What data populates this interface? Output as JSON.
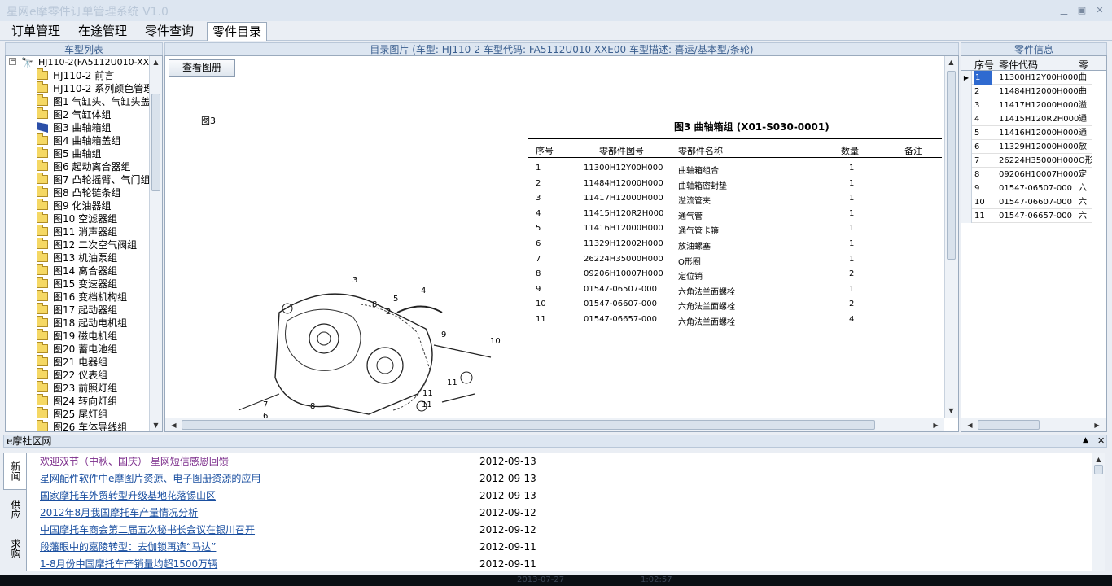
{
  "app": {
    "title": "星网e摩零件订单管理系统 V1.0"
  },
  "menu": [
    "订单管理",
    "在途管理",
    "零件查询",
    "零件目录"
  ],
  "left_panel": {
    "header": "车型列表",
    "root": "HJ110-2(FA5112U010-XXE0",
    "items": [
      "HJ110-2 前言",
      "HJ110-2 系列颜色管理",
      "图1 气缸头、气缸头盖",
      "图2 气缸体组",
      "图3 曲轴箱组",
      "图4 曲轴箱盖组",
      "图5 曲轴组",
      "图6 起动离合器组",
      "图7 凸轮摇臂、气门组",
      "图8 凸轮链条组",
      "图9 化油器组",
      "图10 空滤器组",
      "图11 消声器组",
      "图12 二次空气阀组",
      "图13 机油泵组",
      "图14 离合器组",
      "图15 变速器组",
      "图16 变档机构组",
      "图17 起动器组",
      "图18 起动电机组",
      "图19 磁电机组",
      "图20 蓄电池组",
      "图21 电器组",
      "图22 仪表组",
      "图23 前照灯组",
      "图24 转向灯组",
      "图25 尾灯组",
      "图26 车体导线组"
    ]
  },
  "center_panel": {
    "header": "目录图片 (车型: HJ110-2 车型代码: FA5112U010-XXE00 车型描述: 喜运/基本型/条轮)",
    "button": "查看图册",
    "figure_label": "图3",
    "figure_title": "图3 曲轴箱组 (X01-S030-0001)",
    "table_headers": [
      "序号",
      "零部件图号",
      "零部件名称",
      "数量",
      "备注"
    ],
    "table_rows": [
      [
        "1",
        "11300H12Y00H000",
        "曲轴箱组合",
        "1"
      ],
      [
        "2",
        "11484H12000H000",
        "曲轴箱密封垫",
        "1"
      ],
      [
        "3",
        "11417H12000H000",
        "溢流管夹",
        "1"
      ],
      [
        "4",
        "11415H120R2H000",
        "通气管",
        "1"
      ],
      [
        "5",
        "11416H12000H000",
        "通气管卡箍",
        "1"
      ],
      [
        "6",
        "11329H12002H000",
        "放油螺塞",
        "1"
      ],
      [
        "7",
        "26224H35000H000",
        "O形圈",
        "1"
      ],
      [
        "8",
        "09206H10007H000",
        "定位销",
        "2"
      ],
      [
        "9",
        "01547-06507-000",
        "六角法兰面螺栓",
        "1"
      ],
      [
        "10",
        "01547-06607-000",
        "六角法兰面螺栓",
        "2"
      ],
      [
        "11",
        "01547-06657-000",
        "六角法兰面螺栓",
        "4"
      ]
    ],
    "callouts": [
      "3",
      "4",
      "5",
      "8",
      "2",
      "9",
      "10",
      "7",
      "6",
      "8",
      "11",
      "11",
      "11"
    ]
  },
  "right_panel": {
    "header": "零件信息",
    "columns": [
      "序号",
      "零件代码",
      "零"
    ],
    "rows": [
      [
        "1",
        "11300H12Y00H000",
        "曲"
      ],
      [
        "2",
        "11484H12000H000",
        "曲"
      ],
      [
        "3",
        "11417H12000H000",
        "溢"
      ],
      [
        "4",
        "11415H120R2H000",
        "通"
      ],
      [
        "5",
        "11416H12000H000",
        "通"
      ],
      [
        "6",
        "11329H12000H000",
        "放"
      ],
      [
        "7",
        "26224H35000H000",
        "O形"
      ],
      [
        "8",
        "09206H10007H000",
        "定"
      ],
      [
        "9",
        "01547-06507-000",
        "六"
      ],
      [
        "10",
        "01547-06607-000",
        "六"
      ],
      [
        "11",
        "01547-06657-000",
        "六"
      ]
    ]
  },
  "bottom_panel": {
    "header": "e摩社区网",
    "tabs": [
      "新闻",
      "供应",
      "求购"
    ],
    "news": [
      {
        "title": "欢迎双节（中秋、国庆） 星网短信感恩回馈",
        "date": "2012-09-13"
      },
      {
        "title": "星网配件软件中e摩图片资源、电子图册资源的应用",
        "date": "2012-09-13"
      },
      {
        "title": "国家摩托车外贸转型升级基地花落锡山区",
        "date": "2012-09-13"
      },
      {
        "title": "2012年8月我国摩托车产量情况分析",
        "date": "2012-09-12"
      },
      {
        "title": "中国摩托车商会第二届五次秘书长会议在银川召开",
        "date": "2012-09-12"
      },
      {
        "title": "段藩眼中的嘉陵转型：去伽锁再造“马达”",
        "date": "2012-09-11"
      },
      {
        "title": "1-8月份中国摩托车产销量均超1500万辆",
        "date": "2012-09-11"
      }
    ]
  },
  "status": {
    "date": "2013-07-27",
    "time": "1:02:57"
  }
}
